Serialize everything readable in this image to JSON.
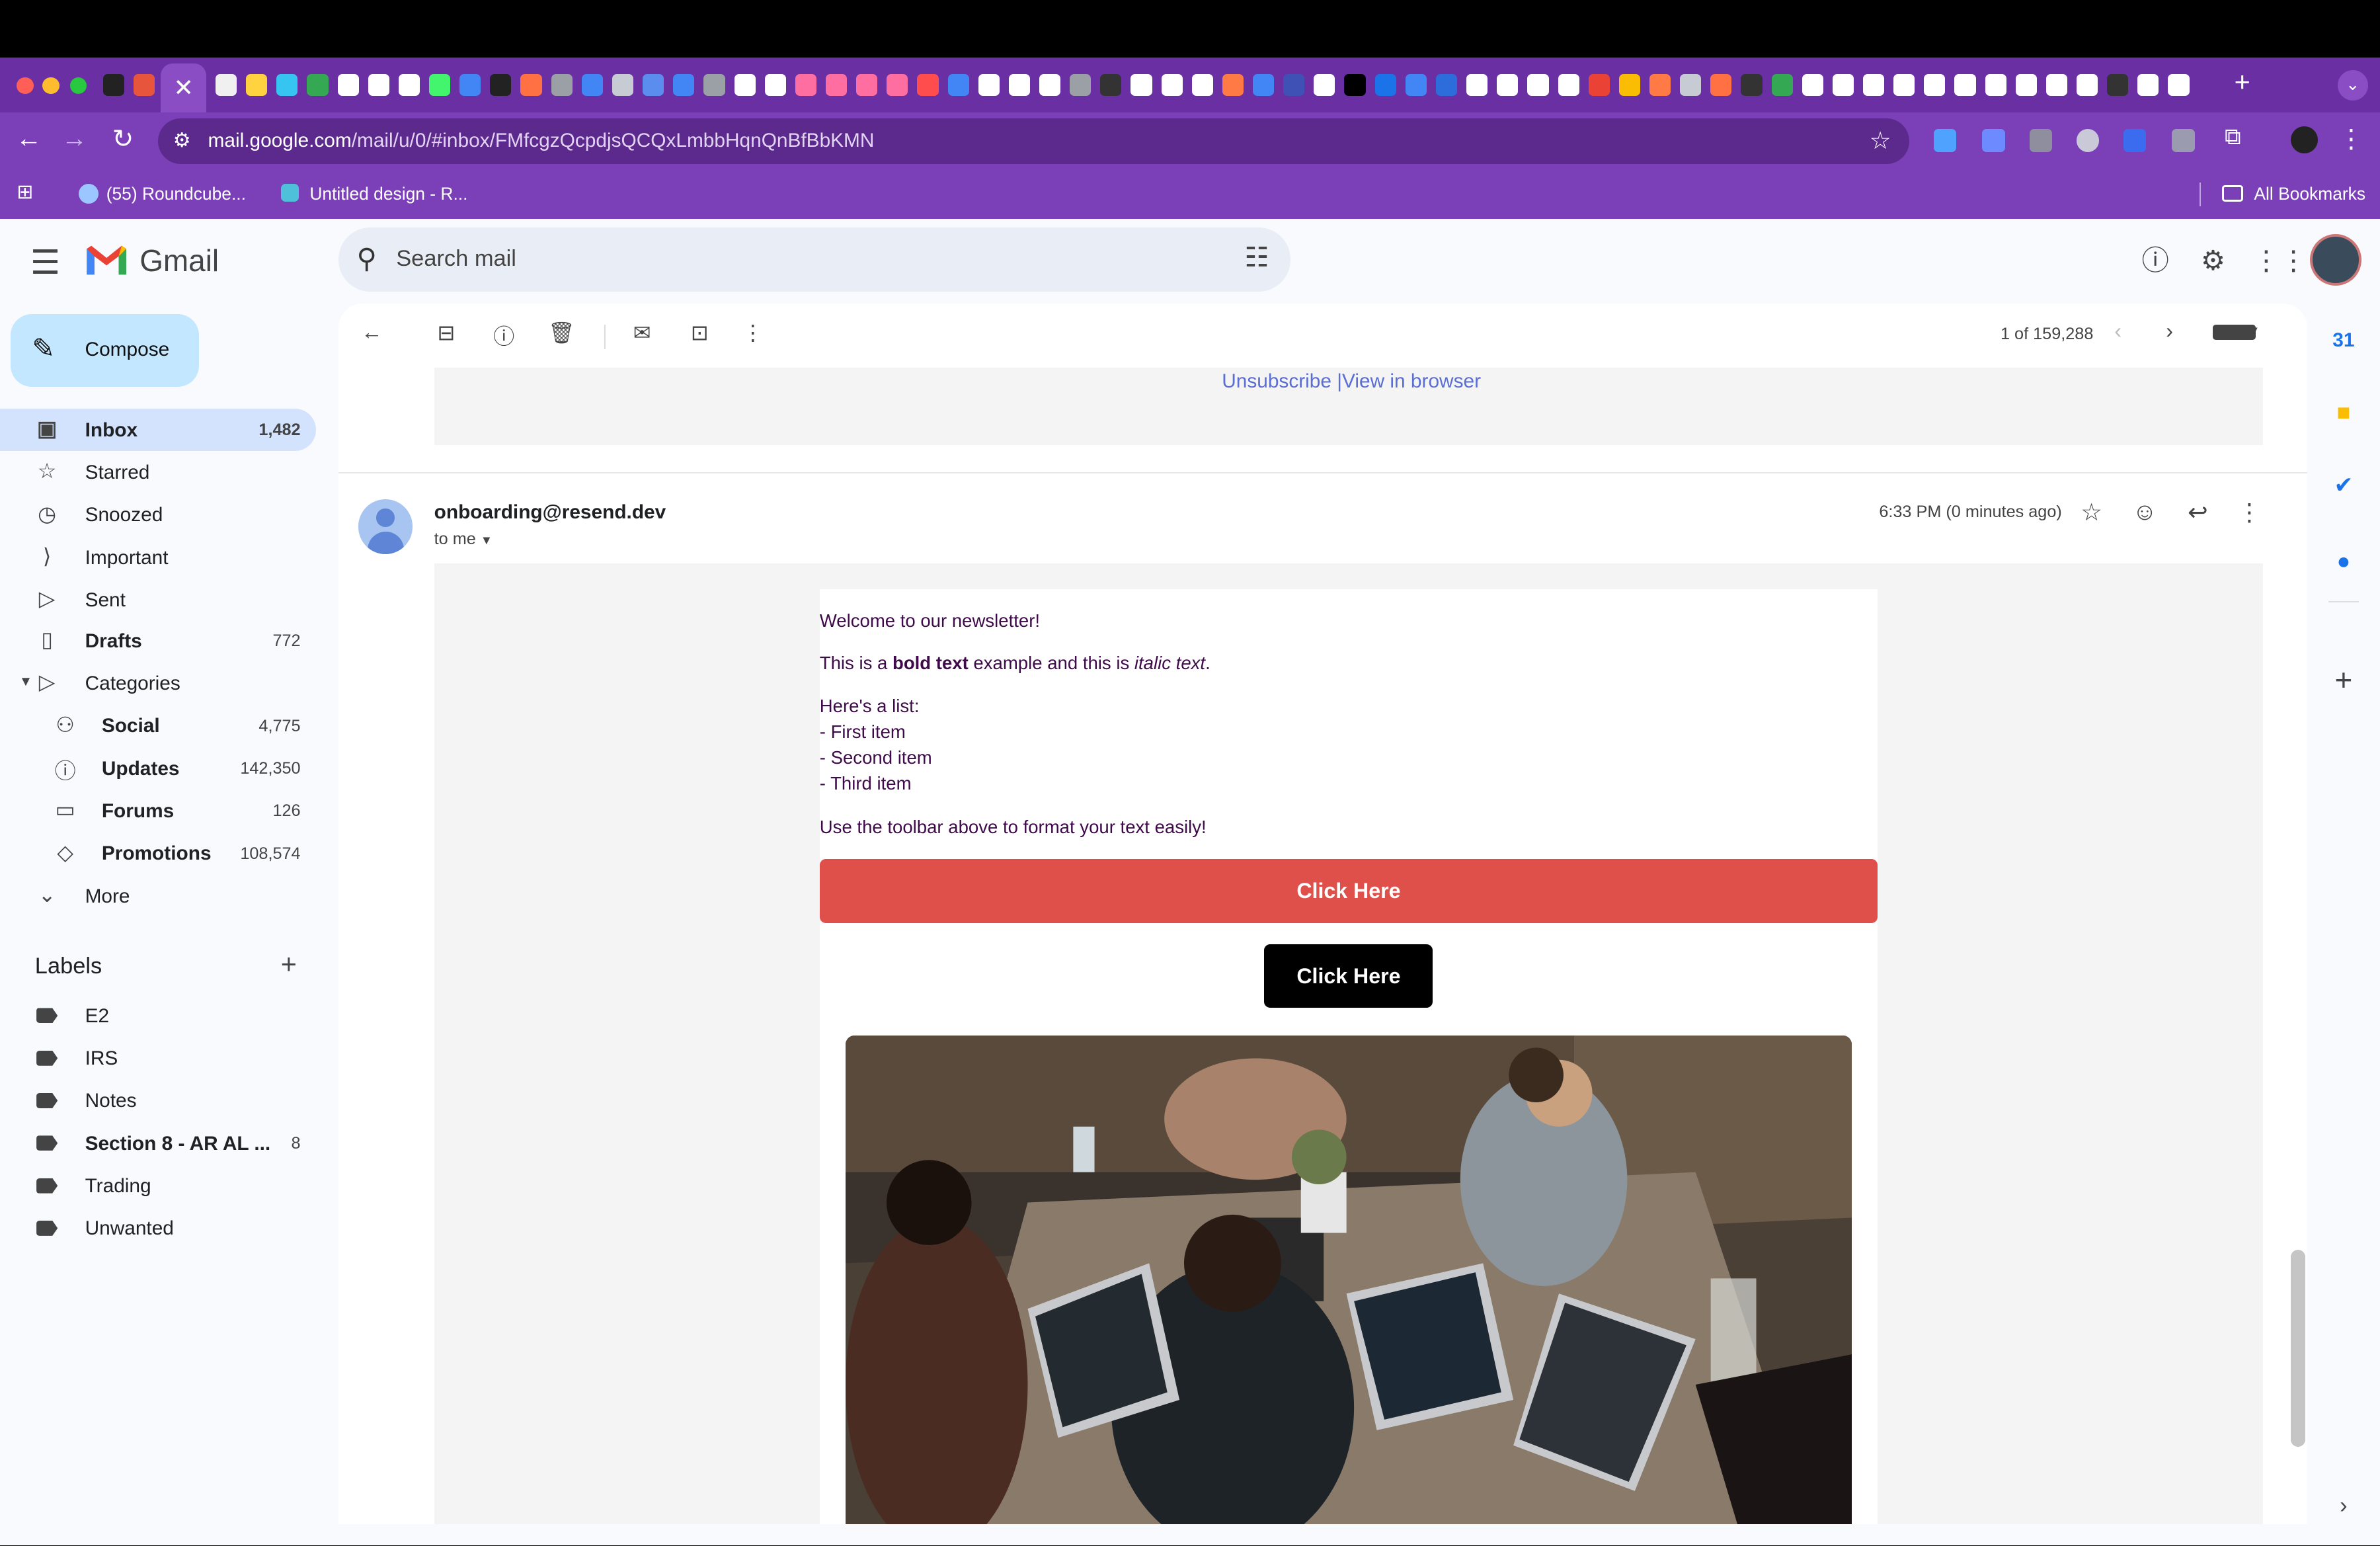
{
  "browser": {
    "active_tab_icon": "close-icon",
    "url_host": "mail.google.com",
    "url_path": "/mail/u/0/#inbox/FMfcgzQcpdjsQCQxLmbbHqnQnBfBbKMN",
    "bookmarks": [
      {
        "label": "(55) Roundcube..."
      },
      {
        "label": "Untitled design - R..."
      }
    ],
    "all_bookmarks_label": "All Bookmarks"
  },
  "gmail": {
    "app_name": "Gmail",
    "search_placeholder": "Search mail",
    "compose_label": "Compose",
    "nav": [
      {
        "label": "Inbox",
        "count": "1,482",
        "icon": "inbox-icon"
      },
      {
        "label": "Starred",
        "count": "",
        "icon": "star-icon"
      },
      {
        "label": "Snoozed",
        "count": "",
        "icon": "clock-icon"
      },
      {
        "label": "Important",
        "count": "",
        "icon": "important-icon"
      },
      {
        "label": "Sent",
        "count": "",
        "icon": "send-icon"
      },
      {
        "label": "Drafts",
        "count": "772",
        "icon": "draft-icon"
      },
      {
        "label": "Categories",
        "count": "",
        "icon": "label-icon"
      }
    ],
    "categories": [
      {
        "label": "Social",
        "count": "4,775",
        "icon": "people-icon"
      },
      {
        "label": "Updates",
        "count": "142,350",
        "icon": "info-icon"
      },
      {
        "label": "Forums",
        "count": "126",
        "icon": "forum-icon"
      },
      {
        "label": "Promotions",
        "count": "108,574",
        "icon": "tag-icon"
      }
    ],
    "more_label": "More",
    "labels_header": "Labels",
    "labels": [
      {
        "label": "E2",
        "count": ""
      },
      {
        "label": "IRS",
        "count": ""
      },
      {
        "label": "Notes",
        "count": ""
      },
      {
        "label": "Section 8 - AR AL ...",
        "count": "8"
      },
      {
        "label": "Trading",
        "count": ""
      },
      {
        "label": "Unwanted",
        "count": ""
      }
    ],
    "pager_text": "1 of 159,288"
  },
  "thread": {
    "prev_footer_unsubscribe": "Unsubscribe",
    "prev_footer_sep": "|",
    "prev_footer_view": "View in browser",
    "sender": "onboarding@resend.dev",
    "to": "to me",
    "time": "6:33 PM (0 minutes ago)",
    "body": {
      "greeting": "Welcome to our newsletter!",
      "line2_pre": "This is a ",
      "line2_bold": "bold text",
      "line2_mid": " example and this is ",
      "line2_italic": "italic text",
      "line2_end": ".",
      "list_header": "Here's a list:",
      "list_items": [
        "- First item",
        "- Second item",
        "- Third item"
      ],
      "toolbar_note": "Use the toolbar above to format your text easily!",
      "button_red": "Click Here",
      "button_black": "Click Here",
      "image": "photo of people working on laptops at a wooden table"
    }
  },
  "colors": {
    "brand_purple": "#6a2fa3",
    "button_red": "#e0504b",
    "body_text": "#3e0a4a",
    "selected_nav": "#d3e3fd",
    "compose_bg": "#c2e7ff"
  }
}
